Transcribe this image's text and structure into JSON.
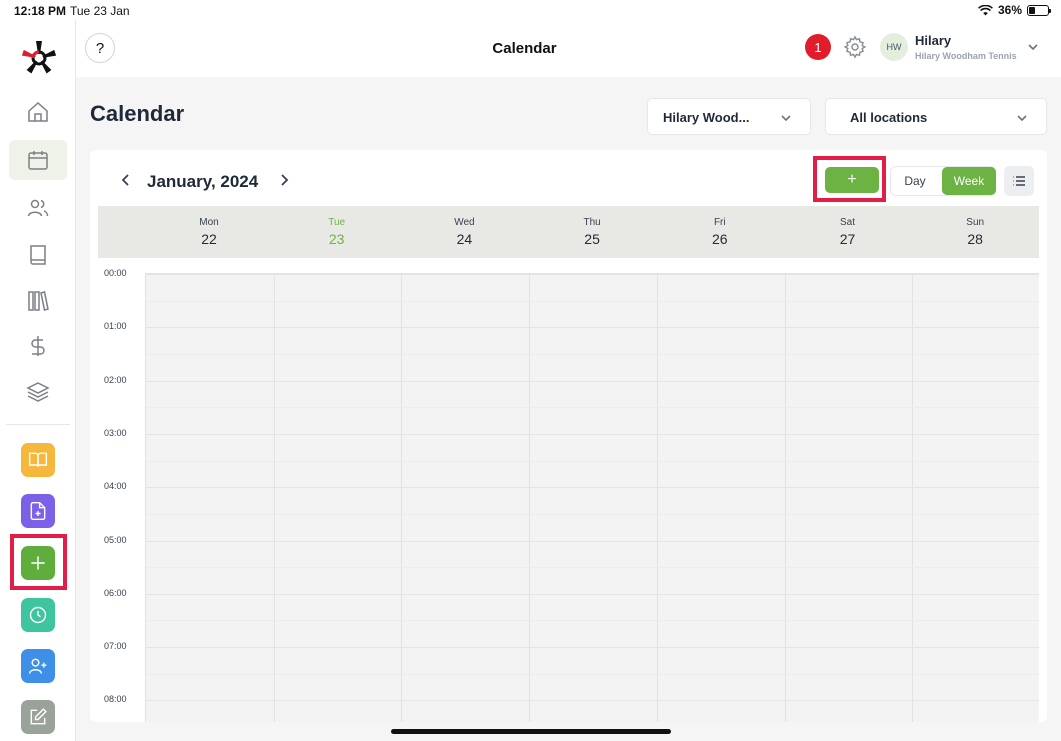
{
  "status_bar": {
    "time": "12:18 PM",
    "date": "Tue 23 Jan",
    "battery": "36%",
    "battery_level": 0.36
  },
  "header": {
    "help_label": "?",
    "title": "Calendar",
    "notification_count": "1",
    "user_initials": "HW",
    "user_name": "Hilary",
    "user_org": "Hilary Woodham Tennis"
  },
  "page": {
    "title": "Calendar",
    "coach_filter": "Hilary Wood...",
    "location_filter": "All locations"
  },
  "sidebar": {
    "nav": [
      {
        "name": "home",
        "icon": "home-icon",
        "active": false
      },
      {
        "name": "calendar",
        "icon": "calendar-icon",
        "active": true
      },
      {
        "name": "people",
        "icon": "users-icon",
        "active": false
      },
      {
        "name": "book",
        "icon": "book-icon",
        "active": false
      },
      {
        "name": "library",
        "icon": "library-icon",
        "active": false
      },
      {
        "name": "payments",
        "icon": "dollar-icon",
        "active": false
      },
      {
        "name": "layers",
        "icon": "layers-icon",
        "active": false
      }
    ],
    "quick_actions": [
      {
        "name": "open-book",
        "icon": "book-open-icon",
        "color": "#f5b83d"
      },
      {
        "name": "new-document",
        "icon": "file-plus-icon",
        "color": "#7b61e8"
      },
      {
        "name": "add",
        "icon": "plus-icon",
        "color": "#5fae3d"
      },
      {
        "name": "clock",
        "icon": "clock-icon",
        "color": "#3fc4a0"
      },
      {
        "name": "add-user",
        "icon": "user-plus-icon",
        "color": "#3d8fe8"
      },
      {
        "name": "edit",
        "icon": "edit-icon",
        "color": "#9aa39a"
      }
    ]
  },
  "calendar": {
    "month_label": "January, 2024",
    "add_label": "+",
    "view_day": "Day",
    "view_week": "Week",
    "days": [
      {
        "name": "Mon",
        "num": "22",
        "today": false
      },
      {
        "name": "Tue",
        "num": "23",
        "today": true
      },
      {
        "name": "Wed",
        "num": "24",
        "today": false
      },
      {
        "name": "Thu",
        "num": "25",
        "today": false
      },
      {
        "name": "Fri",
        "num": "26",
        "today": false
      },
      {
        "name": "Sat",
        "num": "27",
        "today": false
      },
      {
        "name": "Sun",
        "num": "28",
        "today": false
      }
    ],
    "hours": [
      "00:00",
      "01:00",
      "02:00",
      "03:00",
      "04:00",
      "05:00",
      "06:00",
      "07:00",
      "08:00"
    ]
  },
  "colors": {
    "accent": "#6db344",
    "notification": "#e11d2b",
    "highlight": "#e11d48"
  }
}
